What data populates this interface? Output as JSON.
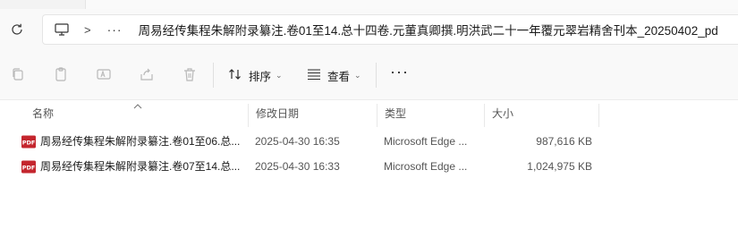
{
  "address": {
    "breadcrumb_separator": ">",
    "overflow": "···",
    "path": "周易经传集程朱解附录纂注.卷01至14.总十四卷.元董真卿撰.明洪武二十一年覆元翠岩精舍刊本_20250402_pd"
  },
  "toolbar": {
    "sort_label": "排序",
    "view_label": "查看",
    "more_label": "···"
  },
  "columns": {
    "name": "名称",
    "modified": "修改日期",
    "type": "类型",
    "size": "大小"
  },
  "files": [
    {
      "name": "周易经传集程朱解附录纂注.卷01至06.总...",
      "modified": "2025-04-30 16:35",
      "type": "Microsoft Edge ...",
      "size": "987,616 KB",
      "icon_label": "PDF"
    },
    {
      "name": "周易经传集程朱解附录纂注.卷07至14.总...",
      "modified": "2025-04-30 16:33",
      "type": "Microsoft Edge ...",
      "size": "1,024,975 KB",
      "icon_label": "PDF"
    }
  ],
  "colors": {
    "pdf_red": "#c4262e",
    "disabled_icon": "#b8b8b8",
    "active_icon": "#2b2b2b"
  }
}
